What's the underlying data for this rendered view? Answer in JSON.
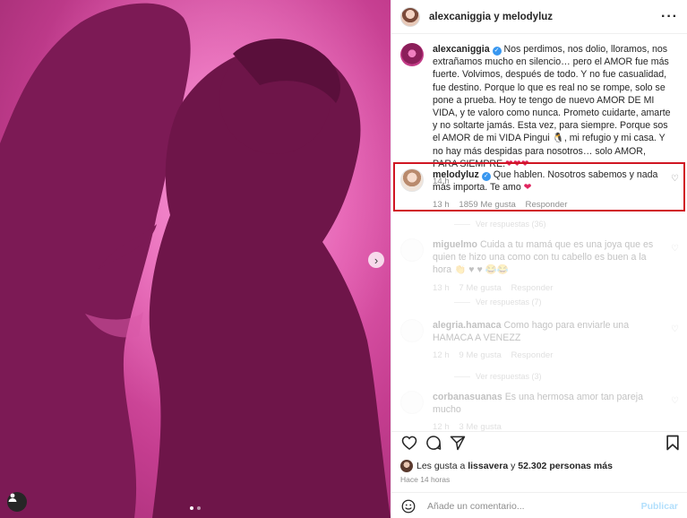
{
  "header": {
    "username": "alexcaniggia y melodyluz"
  },
  "caption": {
    "username": "alexcaniggia",
    "text": "Nos perdimos, nos dolio, lloramos, nos extrañamos mucho en silencio… pero el AMOR fue más fuerte. Volvimos, después de todo. Y no fue casualidad, fue destino. Porque lo que es real no se rompe, solo se pone a prueba. Hoy te tengo de nuevo AMOR DE MI VIDA, y te valoro como nunca. Prometo cuidarte, amarte y no soltarte jamás. Esta vez, para siempre. Porque sos el AMOR de mi VIDA Pingui 🐧, mi refugio y mi casa. Y no hay más despidas para nosotros… solo AMOR, PARA SIEMPRE.",
    "hearts": "❤❤❤",
    "time": "14 h"
  },
  "highlighted_comment": {
    "username": "melodyluz",
    "text": "Que hablen. Nosotros sabemos y nada más importa. Te amo",
    "heart": "❤",
    "time": "13 h",
    "likes": "1859 Me gusta",
    "reply": "Responder",
    "replies": "Ver respuestas (36)"
  },
  "faded_comments": [
    {
      "username": "miguelmo",
      "text": "Cuida a tu mamá que es una joya que es quien te hizo una como con tu cabello es buen a la hora 👏 ♥ ♥ 😂😂",
      "time": "13 h",
      "likes": "7 Me gusta",
      "reply": "Responder",
      "replies": "Ver respuestas (7)"
    },
    {
      "username": "alegria.hamaca",
      "text": "Como hago para enviarle una HAMACA A VENEZZ",
      "time": "12 h",
      "likes": "9 Me gusta",
      "reply": "Responder",
      "replies": "Ver respuestas (3)"
    },
    {
      "username": "corbanasuanas",
      "text": "Es una hermosa amor tan pareja mucho",
      "time": "12 h",
      "likes": "3 Me gusta",
      "reply": "Responder",
      "replies": ""
    }
  ],
  "likes": {
    "prefix": "Les gusta a",
    "first": "lissavera",
    "middle": "y",
    "count": "52.302 personas más"
  },
  "posted": "Hace 14 horas",
  "comment_box": {
    "placeholder": "Añade un comentario...",
    "publish": "Publicar"
  },
  "colors": {
    "accent_red": "#d01623",
    "verified_blue": "#3897f0",
    "heart_red": "#e0245e",
    "photo_pink": "#e25aae"
  },
  "icons": {
    "like": "heart-icon",
    "comment": "comment-icon",
    "share": "share-icon",
    "save": "bookmark-icon",
    "more": "more-options-icon",
    "emoji": "emoji-icon",
    "next": "chevron-right-icon"
  }
}
